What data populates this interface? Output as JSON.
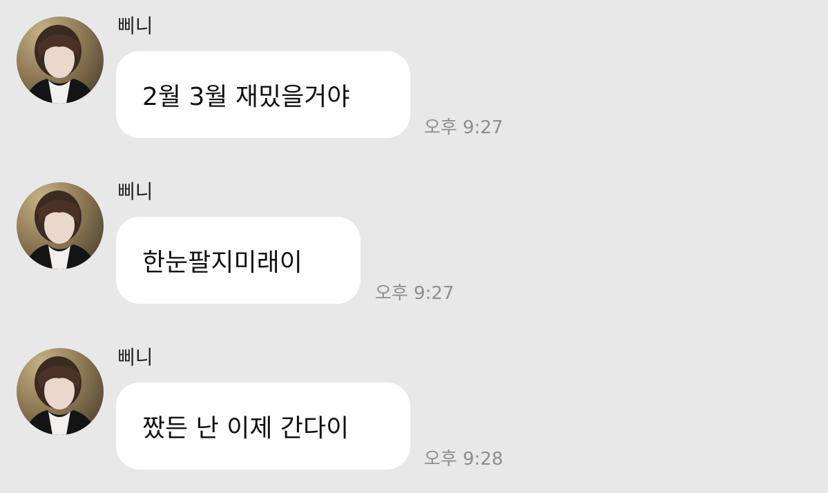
{
  "messages": [
    {
      "sender": "삐니",
      "text": "2월 3월 재밌을거야",
      "time": "오후 9:27"
    },
    {
      "sender": "삐니",
      "text": "한눈팔지미래이",
      "time": "오후 9:27"
    },
    {
      "sender": "삐니",
      "text": "짰든 난 이제 간다이",
      "time": "오후 9:28"
    }
  ],
  "colors": {
    "background": "#e8e8e8",
    "bubble": "#ffffff",
    "time_text": "#8e8e8e"
  }
}
